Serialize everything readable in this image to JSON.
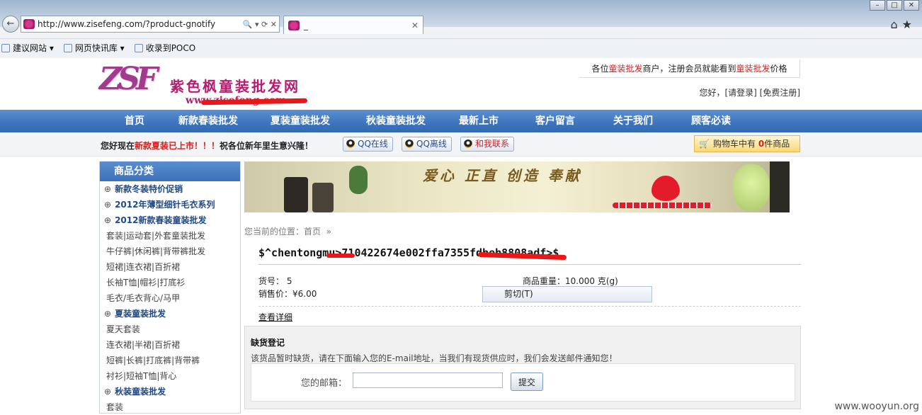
{
  "browser": {
    "url": "http://www.zisefeng.com/?product-gnotify",
    "tab_title": "_",
    "addr_controls": "🔍 ▾ ⟳ ✕",
    "favorites": [
      "建议网站 ▾",
      "网页快讯库 ▾",
      "收录到POCO"
    ]
  },
  "site": {
    "logo_mark": "ZSF",
    "logo_name": "紫色枫童装批发网",
    "logo_url": "www.zisefeng.com",
    "notice_pre": "各位",
    "notice_hl1": "童装批发",
    "notice_mid": "商户，注册会员就能看到",
    "notice_hl2": "童装批发",
    "notice_post": "价格",
    "login_text": "您好，[请登录]  [免费注册]",
    "nav": [
      "首页",
      "新款春装批发",
      "夏装童装批发",
      "秋装童装批发",
      "最新上市",
      "客户留言",
      "关于我们",
      "顾客必读"
    ],
    "greet_pre": "您好现在",
    "greet_hl": "新款夏装已上市！！！",
    "greet_post": "祝各位新年里生意兴隆！",
    "qq_online": "QQ在线",
    "qq_offline": "QQ离线",
    "contact": "和我联系",
    "cart_pre": "购物车中有 ",
    "cart_count": "0",
    "cart_post": "件商品"
  },
  "sidebar": {
    "title": "商品分类",
    "items": [
      {
        "label": "新款冬装特价促销",
        "cat": true
      },
      {
        "label": "2012年薄型细针毛衣系列",
        "cat": true
      },
      {
        "label": "2012新款春装童装批发",
        "cat": true
      },
      {
        "label": "套装|运动套|外套童装批发",
        "cat": false
      },
      {
        "label": "牛仔裤|休闲裤|背带裤批发",
        "cat": false
      },
      {
        "label": "短裙|连衣裙|百折裙",
        "cat": false
      },
      {
        "label": "长袖T恤|帽衫|打底衫",
        "cat": false
      },
      {
        "label": "毛衣/毛衣背心/马甲",
        "cat": false
      },
      {
        "label": "夏装童装批发",
        "cat": true
      },
      {
        "label": "夏天套装",
        "cat": false
      },
      {
        "label": "连衣裙|半裙|百折裙",
        "cat": false
      },
      {
        "label": "短裤|长裤|打底裤|背带裤",
        "cat": false
      },
      {
        "label": "衬衫|短袖T恤|背心",
        "cat": false
      },
      {
        "label": "秋装童装批发",
        "cat": true
      },
      {
        "label": "套装",
        "cat": false
      }
    ]
  },
  "main": {
    "banner_slogan": "爱心 正直 创造 奉献",
    "crumb_pre": "您当前的位置：",
    "crumb_home": "首页",
    "crumb_sep": "»",
    "product_title": "$^chentongmu>710422674e002ffa7355fdbeb8808adf>$",
    "sku_label": "货号：",
    "sku": "5",
    "price_label": "销售价：",
    "price": "¥6.00",
    "weight_label": "商品重量：",
    "weight": "10.000 克(g)",
    "context_menu": "剪切(T)",
    "detail_link": "查看详细",
    "oos_title": "缺货登记",
    "oos_text": "该货品暂时缺货，请在下面输入您的E-mail地址，当我们有现货供应时，我们会发送邮件通知您！",
    "email_label": "您的邮箱：",
    "email_value": "",
    "submit": "提交"
  },
  "watermark": "www.wooyun.org"
}
